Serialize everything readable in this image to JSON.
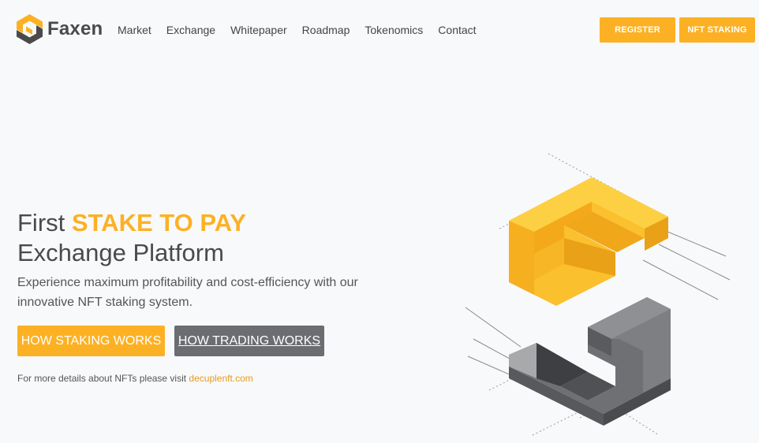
{
  "brand": {
    "name": "Faxen",
    "colors": {
      "accent": "#fcb124",
      "dark": "#4a4a4a",
      "gray_button": "#6b6d70",
      "background": "#f8f9fb"
    }
  },
  "nav": {
    "items": [
      "Market",
      "Exchange",
      "Whitepaper",
      "Roadmap",
      "Tokenomics",
      "Contact"
    ]
  },
  "header_buttons": {
    "register": "REGISTER",
    "nft_staking": "NFT STAKING"
  },
  "hero": {
    "title_prefix": "First ",
    "title_accent": "STAKE TO PAY",
    "title_line2": "Exchange Platform",
    "subtitle": "Experience maximum profitability and cost-efficiency with our innovative NFT staking system.",
    "cta_staking": "HOW STAKING WORKS",
    "cta_trading": "HOW TRADING WORKS",
    "note_text": "For more details about NFTs please visit ",
    "note_link": "decuplenft.com"
  },
  "icons": {
    "logo": "faxen-logo-icon",
    "illustration": "isometric-f-blocks-illustration"
  }
}
